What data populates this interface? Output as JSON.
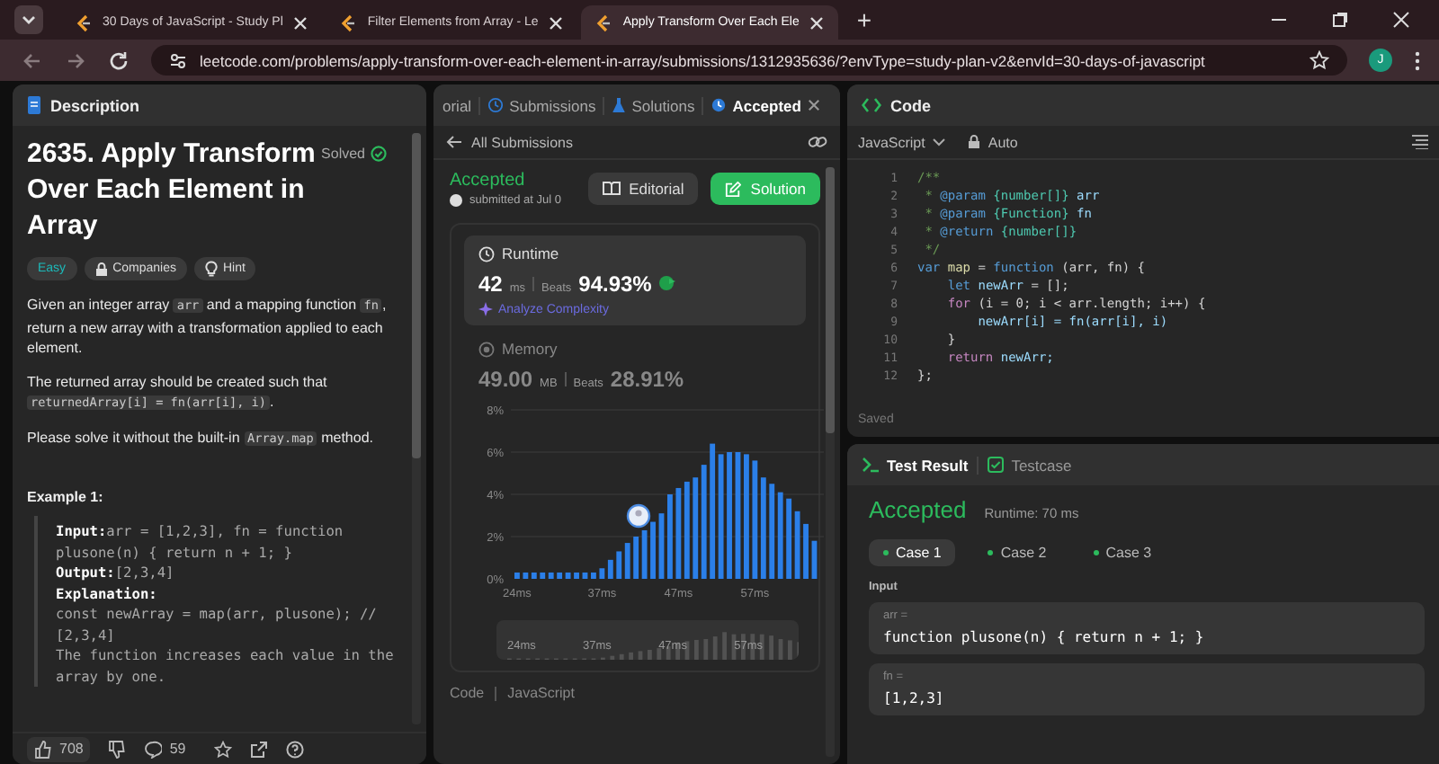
{
  "browser": {
    "tabs": [
      {
        "title": "30 Days of JavaScript - Study Pl",
        "selected": false
      },
      {
        "title": "Filter Elements from Array - Le",
        "selected": false
      },
      {
        "title": "Apply Transform Over Each Ele",
        "selected": true
      }
    ],
    "new_tab": "+",
    "url": "leetcode.com/problems/apply-transform-over-each-element-in-array/submissions/1312935636/?envType=study-plan-v2&envId=30-days-of-javascript",
    "profile_initial": "J"
  },
  "description": {
    "tab": "Description",
    "title": "2635. Apply Transform Over Each Element in Array",
    "status": "Solved",
    "tags": [
      {
        "label": "Easy",
        "kind": "difficulty"
      },
      {
        "label": "Companies",
        "kind": "companies"
      },
      {
        "label": "Hint",
        "kind": "hint"
      }
    ],
    "paragraphs": [
      [
        {
          "t": "Given an integer array ",
          "kind": "text"
        },
        {
          "t": "arr",
          "kind": "code"
        },
        {
          "t": " and a mapping function ",
          "kind": "text"
        },
        {
          "t": "fn",
          "kind": "code"
        },
        {
          "t": ", return a new array with a transformation applied to each element.",
          "kind": "text"
        }
      ],
      [
        {
          "t": "The returned array should be created such that ",
          "kind": "text"
        },
        {
          "t": "returnedArray[i] = fn(arr[i], i)",
          "kind": "code"
        },
        {
          "t": ".",
          "kind": "text"
        }
      ],
      [
        {
          "t": "Please solve it without the built-in ",
          "kind": "text"
        },
        {
          "t": "Array.map",
          "kind": "code"
        },
        {
          "t": " method.",
          "kind": "text"
        }
      ]
    ],
    "example": {
      "heading": "Example 1:",
      "lines": [
        {
          "label": "Input:",
          "text": "arr = [1,2,3], fn = function plusone(n) { return n + 1; }"
        },
        {
          "label": "Output:",
          "text": "[2,3,4]"
        },
        {
          "label": "Explanation:"
        },
        {
          "text": "const newArray = map(arr, plusone); // [2,3,4]"
        },
        {
          "text": "The function increases each value in the array by one."
        }
      ]
    },
    "footer": {
      "likes": "708",
      "comments": "59"
    }
  },
  "submission": {
    "tabs": [
      {
        "label": "orial",
        "kind": "editorial",
        "selected": false
      },
      {
        "label": "Submissions",
        "kind": "submissions",
        "selected": false
      },
      {
        "label": "Solutions",
        "kind": "solutions",
        "selected": false
      },
      {
        "label": "Accepted",
        "kind": "accepted",
        "selected": true
      }
    ],
    "back": "All Submissions",
    "status": "Accepted",
    "submitted": "submitted at Jul 0",
    "editorial_button": "Editorial",
    "solution_button": "Solution",
    "runtime": {
      "label": "Runtime",
      "value": "42",
      "unit": "ms",
      "beats_label": "Beats",
      "beats": "94.93%",
      "analyze": "Analyze Complexity"
    },
    "memory": {
      "label": "Memory",
      "value": "49.00",
      "unit": "MB",
      "beats_label": "Beats",
      "beats": "28.91%"
    },
    "chart_data": {
      "type": "bar",
      "values": [
        0.3,
        0.3,
        0.3,
        0.3,
        0.3,
        0.3,
        0.3,
        0.3,
        0.3,
        0.3,
        0.5,
        0.9,
        1.3,
        1.7,
        2.0,
        2.3,
        2.7,
        3.1,
        4.0,
        4.3,
        4.6,
        4.8,
        5.4,
        6.4,
        5.9,
        6.0,
        6.0,
        5.9,
        5.6,
        4.8,
        4.5,
        4.1,
        3.8,
        3.2,
        2.6,
        1.8
      ],
      "ylim": [
        0,
        8
      ],
      "yticks": [
        {
          "value": 0,
          "label": "0%"
        },
        {
          "value": 2,
          "label": "2%"
        },
        {
          "value": 4,
          "label": "4%"
        },
        {
          "value": 6,
          "label": "6%"
        },
        {
          "value": 8,
          "label": "8%"
        }
      ],
      "categories": [
        "24ms",
        null,
        null,
        null,
        null,
        null,
        null,
        null,
        null,
        null,
        "37ms",
        null,
        null,
        null,
        null,
        null,
        null,
        null,
        null,
        "47ms",
        null,
        null,
        null,
        null,
        null,
        null,
        null,
        null,
        "57ms",
        null,
        null,
        null,
        null,
        null,
        null,
        null
      ],
      "grid": true
    },
    "navigator_labels": [
      "24ms",
      "37ms",
      "47ms",
      "57ms"
    ],
    "code_label": "Code",
    "code_language": "JavaScript"
  },
  "editor": {
    "tab": "Code",
    "language": "JavaScript",
    "mode": "Auto",
    "status": "Saved",
    "lines": [
      {
        "n": "1",
        "tokens": [
          {
            "t": "/**",
            "kind": "comment"
          }
        ]
      },
      {
        "n": "2",
        "tokens": [
          {
            "t": " * ",
            "kind": "comment"
          },
          {
            "t": "@param",
            "kind": "tag"
          },
          {
            "t": " {number[]}",
            "kind": "type"
          },
          {
            "t": " arr",
            "kind": "var"
          }
        ]
      },
      {
        "n": "3",
        "tokens": [
          {
            "t": " * ",
            "kind": "comment"
          },
          {
            "t": "@param",
            "kind": "tag"
          },
          {
            "t": " {Function}",
            "kind": "type"
          },
          {
            "t": " fn",
            "kind": "var"
          }
        ]
      },
      {
        "n": "4",
        "tokens": [
          {
            "t": " * ",
            "kind": "comment"
          },
          {
            "t": "@return",
            "kind": "tag"
          },
          {
            "t": " {number[]}",
            "kind": "type"
          }
        ]
      },
      {
        "n": "5",
        "tokens": [
          {
            "t": " */",
            "kind": "comment"
          }
        ]
      },
      {
        "n": "6",
        "tokens": [
          {
            "t": "var",
            "kind": "keyword"
          },
          {
            "t": " map",
            "kind": "func"
          },
          {
            "t": " = ",
            "kind": "plain"
          },
          {
            "t": "function",
            "kind": "keyword"
          },
          {
            "t": " (arr, fn) {",
            "kind": "plain"
          }
        ]
      },
      {
        "n": "7",
        "tokens": [
          {
            "t": "    let",
            "kind": "keyword"
          },
          {
            "t": " newArr",
            "kind": "var"
          },
          {
            "t": " = [];",
            "kind": "plain"
          }
        ]
      },
      {
        "n": "8",
        "tokens": [
          {
            "t": "    for",
            "kind": "control"
          },
          {
            "t": " (i = 0; i < arr.length; i++) {",
            "kind": "plain"
          }
        ]
      },
      {
        "n": "9",
        "tokens": [
          {
            "t": "        newArr[i] = fn(arr[i], i)",
            "kind": "var"
          }
        ]
      },
      {
        "n": "10",
        "tokens": [
          {
            "t": "    }",
            "kind": "plain"
          }
        ]
      },
      {
        "n": "11",
        "tokens": [
          {
            "t": "    return",
            "kind": "control"
          },
          {
            "t": " newArr;",
            "kind": "var"
          }
        ]
      },
      {
        "n": "12",
        "tokens": [
          {
            "t": "};",
            "kind": "plain"
          }
        ]
      }
    ]
  },
  "test": {
    "tabs": [
      {
        "label": "Test Result",
        "kind": "result",
        "selected": true
      },
      {
        "label": "Testcase",
        "kind": "testcase",
        "selected": false
      }
    ],
    "status": "Accepted",
    "runtime": "Runtime: 70 ms",
    "cases": [
      {
        "label": "Case 1",
        "passed": true,
        "selected": true
      },
      {
        "label": "Case 2",
        "passed": true,
        "selected": false
      },
      {
        "label": "Case 3",
        "passed": true,
        "selected": false
      }
    ],
    "input_label": "Input",
    "inputs": [
      {
        "name": "arr =",
        "value": "function plusone(n) { return n + 1; }"
      },
      {
        "name": "fn =",
        "value": "[1,2,3]"
      }
    ]
  }
}
